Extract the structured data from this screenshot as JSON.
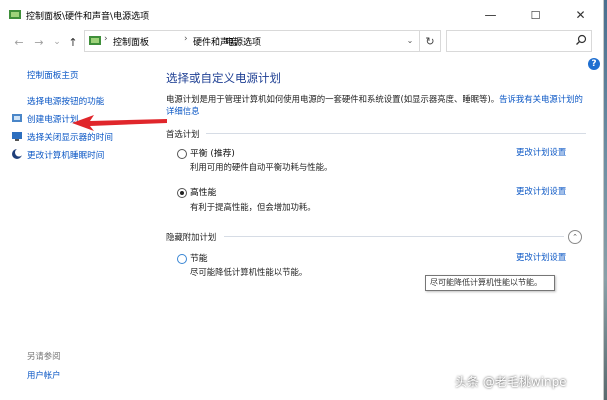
{
  "window": {
    "title": "控制面板\\硬件和声音\\电源选项",
    "minimize": "—",
    "maximize": "☐",
    "close": "✕"
  },
  "nav": {
    "back": "←",
    "forward": "→",
    "recent": "⌄",
    "up": "↑",
    "breadcrumbs": [
      "控制面板",
      "硬件和声音",
      "电源选项"
    ],
    "separator": "›",
    "dropdown": "⌄",
    "refresh": "↻"
  },
  "sidebar": {
    "home": "控制面板主页",
    "items": [
      "选择电源按钮的功能",
      "创建电源计划",
      "选择关闭显示器的时间",
      "更改计算机睡眠时间"
    ],
    "see_also": "另请参阅",
    "user_accounts": "用户帐户"
  },
  "main": {
    "title": "选择或自定义电源计划",
    "description": "电源计划是用于管理计算机如何使用电源的一套硬件和系统设置(如显示器亮度、睡眠等)。",
    "description_link": "告诉我有关电源计划的详细信息",
    "preferred_heading": "首选计划",
    "hidden_heading": "隐藏附加计划",
    "plans": [
      {
        "name": "平衡 (推荐)",
        "desc": "利用可用的硬件自动平衡功耗与性能。",
        "link": "更改计划设置",
        "selected": false
      },
      {
        "name": "高性能",
        "desc": "有利于提高性能，但会增加功耗。",
        "link": "更改计划设置",
        "selected": true
      }
    ],
    "hidden_plans": [
      {
        "name": "节能",
        "desc": "尽可能降低计算机性能以节能。",
        "link": "更改计划设置",
        "selected": false
      }
    ],
    "tooltip": "尽可能降低计算机性能以节能。",
    "help": "?",
    "collapse": "⌃"
  },
  "watermark": "头条 @老毛桃winpe",
  "colors": {
    "link": "#0b57c5",
    "title": "#1e3f93",
    "arrow": "#e0262b"
  }
}
